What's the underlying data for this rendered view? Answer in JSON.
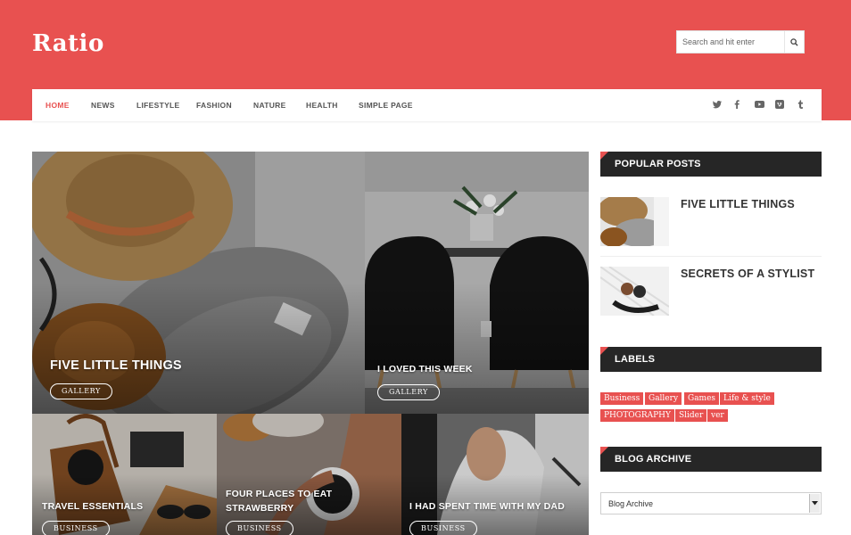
{
  "site": {
    "title": "Ratio"
  },
  "search": {
    "placeholder": "Search and hit enter"
  },
  "nav": {
    "items": [
      "HOME",
      "NEWS",
      "LIFESTYLE",
      "FASHION",
      "NATURE",
      "HEALTH",
      "SIMPLE PAGE"
    ],
    "social": [
      "twitter-icon",
      "facebook-icon",
      "youtube-icon",
      "vimeo-icon",
      "tumblr-icon"
    ]
  },
  "featured": [
    {
      "title": "FIVE LITTLE THINGS",
      "button": "GALLERY"
    },
    {
      "title": "I LOVED THIS WEEK",
      "button": "GALLERY"
    },
    {
      "title": "TRAVEL ESSENTIALS",
      "button": "BUSINESS"
    },
    {
      "title": "FOUR PLACES TO EAT STRAWBERRY",
      "button": "BUSINESS"
    },
    {
      "title": "I HAD SPENT TIME WITH MY DAD",
      "button": "BUSINESS"
    }
  ],
  "sidebar": {
    "popular": {
      "heading": "POPULAR POSTS",
      "posts": [
        {
          "title": "FIVE LITTLE THINGS"
        },
        {
          "title": "SECRETS OF A STYLIST"
        }
      ]
    },
    "labels": {
      "heading": "LABELS",
      "items": [
        "Business",
        "Gallery",
        "Games",
        "Life & style",
        "PHOTOGRAPHY",
        "Slider",
        "ver"
      ]
    },
    "archive": {
      "heading": "BLOG ARCHIVE",
      "selected": "Blog Archive"
    }
  },
  "colors": {
    "accent": "#e85150",
    "dark": "#262626"
  }
}
